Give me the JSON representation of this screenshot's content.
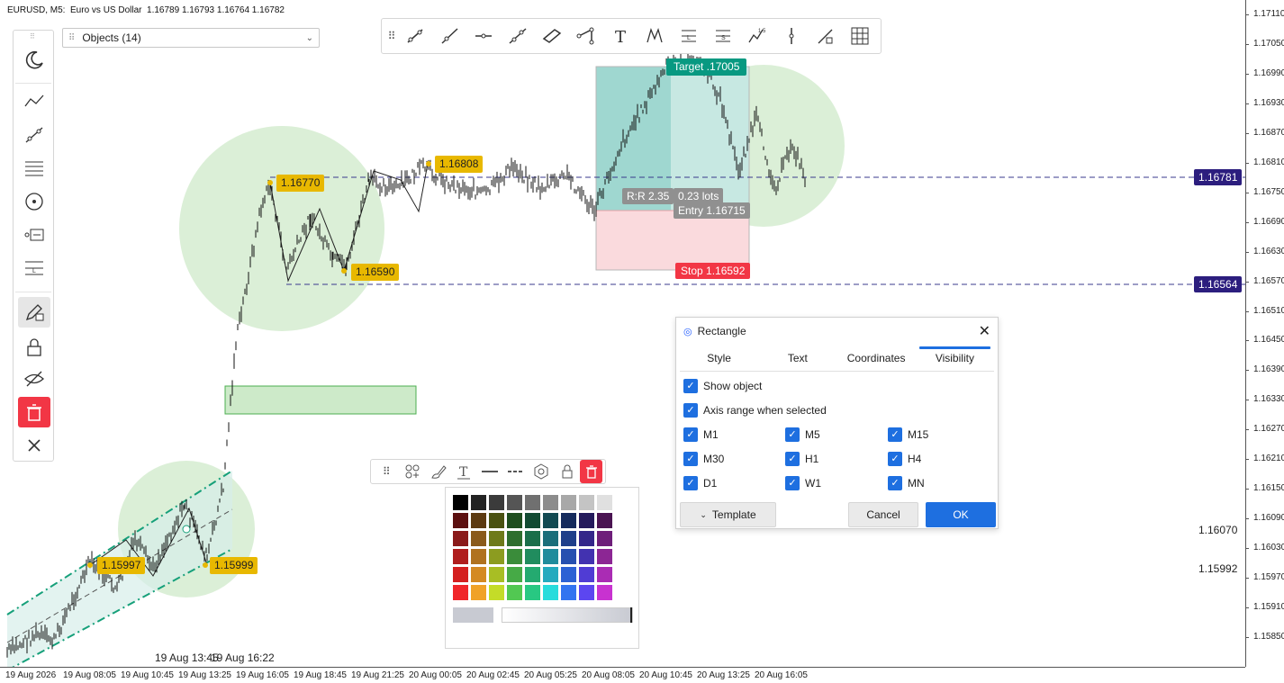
{
  "chart": {
    "symbol_line": "EURUSD, M5:  Euro vs US Dollar  1.16789 1.16793 1.16764 1.16782",
    "objects_dropdown": "Objects (14)",
    "price_axis": [
      "1.17110",
      "1.17050",
      "1.16990",
      "1.16930",
      "1.16870",
      "1.16810",
      "1.16750",
      "1.16690",
      "1.16630",
      "1.16570",
      "1.16510",
      "1.16450",
      "1.16390",
      "1.16330",
      "1.16270",
      "1.16210",
      "1.16150",
      "1.16090",
      "1.16030",
      "1.15970",
      "1.15910",
      "1.15850"
    ],
    "time_axis": [
      "19 Aug 2026",
      "19 Aug 08:05",
      "19 Aug 10:45",
      "19 Aug 13:25",
      "19 Aug 16:05",
      "19 Aug 18:45",
      "19 Aug 21:25",
      "20 Aug 00:05",
      "20 Aug 02:45",
      "20 Aug 05:25",
      "20 Aug 08:05",
      "20 Aug 10:45",
      "20 Aug 13:25",
      "20 Aug 16:05"
    ],
    "hline_tags": [
      "1.16781",
      "1.16564"
    ],
    "side_prices": [
      "1.16070",
      "1.15992"
    ],
    "labels": {
      "p_16770": "1.16770",
      "p_16808": "1.16808",
      "p_16590": "1.16590",
      "p_15997": "1.15997",
      "p_15999": "1.15999",
      "target": "Target .17005",
      "rr": "R:R 2.35",
      "lots": "0.23 lots",
      "entry": "Entry 1.16715",
      "stop": "Stop 1.16592",
      "time_a": "19 Aug 13:45",
      "time_b": "19 Aug 16:22"
    }
  },
  "dialog": {
    "title": "Rectangle",
    "close": "✕",
    "tabs": [
      "Style",
      "Text",
      "Coordinates",
      "Visibility"
    ],
    "active_tab": "Visibility",
    "show_object": "Show object",
    "axis_range": "Axis range when selected",
    "timeframes": [
      "M1",
      "M5",
      "M15",
      "M30",
      "H1",
      "H4",
      "D1",
      "W1",
      "MN"
    ],
    "template": "Template",
    "cancel": "Cancel",
    "ok": "OK"
  },
  "palette": {
    "rows": [
      [
        "#000000",
        "#222222",
        "#3b3b3b",
        "#555555",
        "#707070",
        "#8c8c8c",
        "#a8a8a8",
        "#c4c4c4",
        "#e0e0e0"
      ],
      [
        "#5c1010",
        "#5c3a10",
        "#4a5212",
        "#1e4d1e",
        "#124a32",
        "#124a52",
        "#142a5c",
        "#241a5c",
        "#4a1452"
      ],
      [
        "#8a1a1a",
        "#8a5a1a",
        "#6e7a1a",
        "#2e6e2e",
        "#1a6e4a",
        "#1a6e7a",
        "#1e3e8a",
        "#34268a",
        "#6e1e7a"
      ],
      [
        "#b01e1e",
        "#b0721e",
        "#8c9c20",
        "#3a8c3a",
        "#208c5e",
        "#208c9c",
        "#2650b0",
        "#4232b0",
        "#8c2694"
      ],
      [
        "#d42020",
        "#d48a22",
        "#a8be24",
        "#46aa46",
        "#24aa70",
        "#24aabe",
        "#2c62d4",
        "#503cd4",
        "#aa2cb4"
      ],
      [
        "#f0262a",
        "#f0a228",
        "#c4dc28",
        "#52c852",
        "#28c882",
        "#28dcdc",
        "#3274f0",
        "#5c46f0",
        "#c832d0"
      ]
    ]
  },
  "colors": {
    "accent_blue": "#1e6fe0",
    "tag_navy": "#2c1e7e",
    "chip_yellow": "#e8b800",
    "target_green": "#089981",
    "stop_red": "#f23645",
    "circle_green": "#c8e6c2"
  }
}
